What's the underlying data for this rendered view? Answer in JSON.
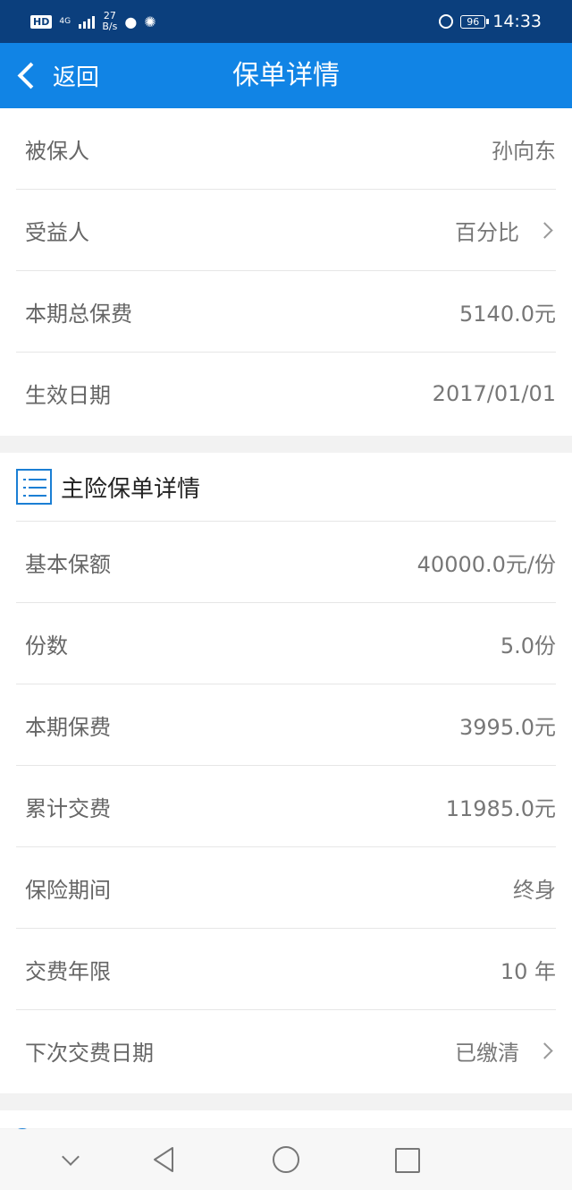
{
  "status_bar": {
    "hd": "HD",
    "network": "4G",
    "speed_value": "27",
    "speed_unit": "B/s",
    "chat_icon": "message-bubble-icon",
    "alipay_icon": "alipay-icon",
    "battery": "96",
    "time": "14:33"
  },
  "nav": {
    "back_label": "返回",
    "title": "保单详情"
  },
  "summary_rows": [
    {
      "label": "被保人",
      "value": "孙向东"
    },
    {
      "label": "受益人",
      "value": "百分比"
    },
    {
      "label": "本期总保费",
      "value": "5140.0元"
    },
    {
      "label": "生效日期",
      "value": "2017/01/01"
    }
  ],
  "main_section": {
    "title": "主险保单详情",
    "rows": [
      {
        "label": "基本保额",
        "value": "40000.0元/份"
      },
      {
        "label": "份数",
        "value": "5.0份"
      },
      {
        "label": "本期保费",
        "value": "3995.0元"
      },
      {
        "label": "累计交费",
        "value": "11985.0元"
      },
      {
        "label": "保险期间",
        "value": "终身"
      },
      {
        "label": "交费年限",
        "value": "10 年"
      },
      {
        "label": "下次交费日期",
        "value": "已缴清"
      }
    ]
  },
  "colors": {
    "status_bar": "#0b3f7d",
    "nav_bar": "#1184e5",
    "accent": "#1b7fd4"
  }
}
